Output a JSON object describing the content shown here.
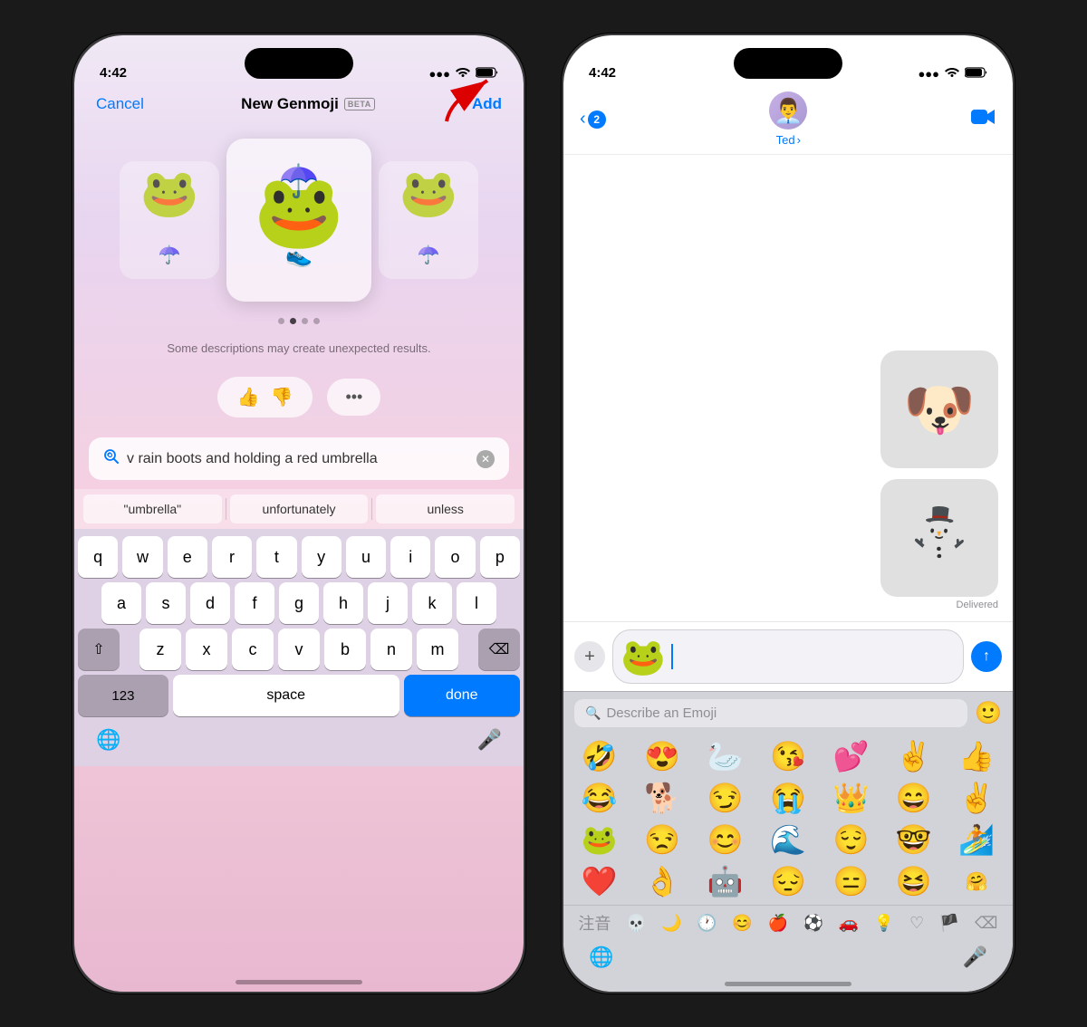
{
  "phone1": {
    "status": {
      "time": "4:42",
      "signal": "●●●",
      "wifi": "WiFi",
      "battery": "🔋"
    },
    "nav": {
      "cancel": "Cancel",
      "title": "New Genmoji",
      "beta": "BETA",
      "add": "Add"
    },
    "warning": "Some descriptions may create\nunexpected results.",
    "search_text": "v rain boots and holding a red umbrella",
    "autocomplete": [
      "\"umbrella\"",
      "unfortunately",
      "unless"
    ],
    "keyboard_rows": [
      [
        "q",
        "w",
        "e",
        "r",
        "t",
        "y",
        "u",
        "i",
        "o",
        "p"
      ],
      [
        "a",
        "s",
        "d",
        "f",
        "g",
        "h",
        "j",
        "k",
        "l"
      ],
      [
        "z",
        "x",
        "c",
        "v",
        "b",
        "n",
        "m"
      ],
      [
        "123",
        "space",
        "done"
      ]
    ]
  },
  "phone2": {
    "status": {
      "time": "4:42",
      "signal": "●●●",
      "wifi": "WiFi",
      "battery": "🔋"
    },
    "nav": {
      "back_count": "2",
      "contact": "Ted",
      "chevron": "›"
    },
    "messages": [
      {
        "type": "image",
        "emoji": "🐶",
        "side": "right"
      },
      {
        "type": "image",
        "emoji": "⛄",
        "side": "right",
        "delivered": "Delivered"
      },
      {
        "type": "sticker",
        "emoji": "🐸☂️",
        "side": "left"
      }
    ],
    "emoji_search_placeholder": "Describe an Emoji",
    "emojis_row1": [
      "🤣",
      "😍",
      "🦢",
      "😘",
      "💕",
      "✌️",
      "👍"
    ],
    "emojis_row2": [
      "😂",
      "🐕",
      "😏",
      "😭",
      "👑",
      "😄",
      "✌️"
    ],
    "emojis_row3": [
      "🐸",
      "😒",
      "😊",
      "🌊",
      "😌",
      "🤓",
      "🏄"
    ],
    "emojis_row4": [
      "❤️",
      "👌",
      "🤖",
      "😔",
      "😑",
      "😆",
      "🤗"
    ]
  }
}
